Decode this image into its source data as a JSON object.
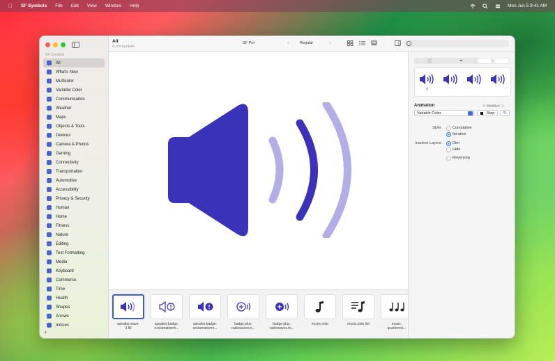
{
  "menubar": {
    "app_name": "SF Symbols",
    "menus": [
      "File",
      "Edit",
      "View",
      "Window",
      "Help"
    ],
    "clock": "Mon Jun 5  9:41 AM"
  },
  "sidebar": {
    "heading": "SF Symbols",
    "items": [
      {
        "label": "All"
      },
      {
        "label": "What's New"
      },
      {
        "label": "Multicolor"
      },
      {
        "label": "Variable Color"
      },
      {
        "label": "Communication"
      },
      {
        "label": "Weather"
      },
      {
        "label": "Maps"
      },
      {
        "label": "Objects & Tools"
      },
      {
        "label": "Devices"
      },
      {
        "label": "Camera & Photos"
      },
      {
        "label": "Gaming"
      },
      {
        "label": "Connectivity"
      },
      {
        "label": "Transportation"
      },
      {
        "label": "Automotive"
      },
      {
        "label": "Accessibility"
      },
      {
        "label": "Privacy & Security"
      },
      {
        "label": "Human"
      },
      {
        "label": "Home"
      },
      {
        "label": "Fitness"
      },
      {
        "label": "Nature"
      },
      {
        "label": "Editing"
      },
      {
        "label": "Text Formatting"
      },
      {
        "label": "Media"
      },
      {
        "label": "Keyboard"
      },
      {
        "label": "Commerce"
      },
      {
        "label": "Time"
      },
      {
        "label": "Health"
      },
      {
        "label": "Shapes"
      },
      {
        "label": "Arrows"
      },
      {
        "label": "Indices"
      }
    ],
    "add_label": "+"
  },
  "toolbar": {
    "title": "All",
    "subtitle": "5,173 Symbols",
    "font_select": "SF Pro",
    "weight_select": "Regular"
  },
  "strip": {
    "tiles": [
      {
        "label": "speaker.wave.\n3.fill"
      },
      {
        "label": "speaker.badge.\nexclamationm..."
      },
      {
        "label": "speaker.badge.\nexclamationm..."
      },
      {
        "label": "badge.plus.\nradiowaves.ri..."
      },
      {
        "label": "badge.plus.\nradiowaves.fo..."
      },
      {
        "label": "music.note"
      },
      {
        "label": "music.note.list"
      },
      {
        "label": "music.\nquarternot..."
      }
    ]
  },
  "inspector": {
    "preview_counter": "0",
    "animation_heading": "Animation",
    "modified_label": "Modified",
    "animation_select": "Variable Color",
    "stop_label": "Stop",
    "style_label": "Style:",
    "style_options": [
      "Cumulative",
      "Iterative"
    ],
    "inactive_label": "Inactive Layers:",
    "inactive_options": [
      "Dim",
      "Hide"
    ],
    "reversing_label": "Reversing"
  },
  "colors": {
    "symbol_primary": "#3a32b8",
    "symbol_dim": "#b3aee6",
    "accent": "#2f6fe0"
  }
}
